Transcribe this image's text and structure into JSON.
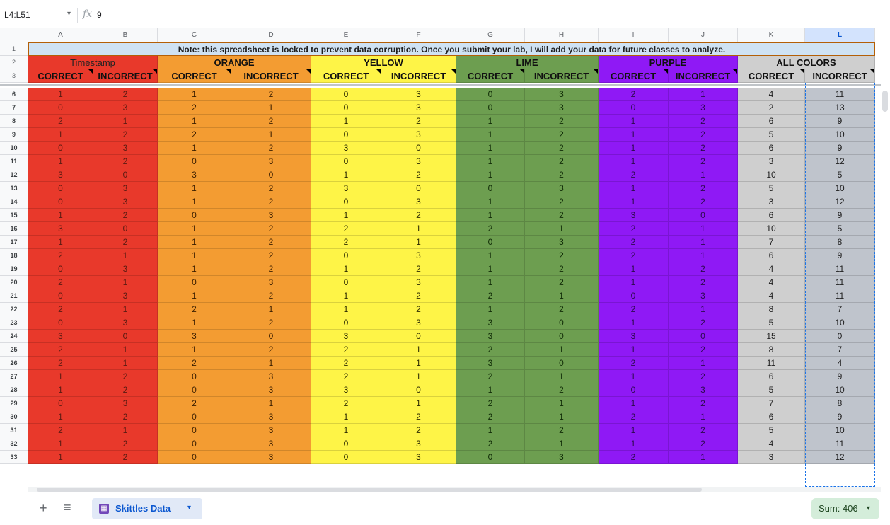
{
  "formula_bar": {
    "name_box": "L4:L51",
    "fx": "fx",
    "value": "9"
  },
  "columns": [
    "A",
    "B",
    "C",
    "D",
    "E",
    "F",
    "G",
    "H",
    "I",
    "J",
    "K",
    "L"
  ],
  "selected_column": "L",
  "top_rows": [
    "1",
    "2",
    "3"
  ],
  "note": "Note: this spreadsheet is locked to prevent data corruption. Once you submit your lab, I will add your data for future classes to analyze.",
  "headers": {
    "timestamp": "Timestamp",
    "orange": "ORANGE",
    "yellow": "YELLOW",
    "lime": "LIME",
    "purple": "PURPLE",
    "all_colors": "ALL COLORS",
    "correct": "CORRECT",
    "incorrect": "INCORRECT"
  },
  "colors": {
    "red": "#e8392b",
    "orange": "#f39c32",
    "yellow": "#fef447",
    "lime": "#6d9e50",
    "purple": "#8f19f5",
    "gray": "#cfcfcf",
    "gray_sel": "#bfc4cc",
    "note_bg": "#cfe2f3"
  },
  "rows": [
    {
      "n": "6",
      "v": [
        "1",
        "2",
        "1",
        "2",
        "0",
        "3",
        "0",
        "3",
        "2",
        "1",
        "4",
        "11"
      ]
    },
    {
      "n": "7",
      "v": [
        "0",
        "3",
        "2",
        "1",
        "0",
        "3",
        "0",
        "3",
        "0",
        "3",
        "2",
        "13"
      ]
    },
    {
      "n": "8",
      "v": [
        "2",
        "1",
        "1",
        "2",
        "1",
        "2",
        "1",
        "2",
        "1",
        "2",
        "6",
        "9"
      ]
    },
    {
      "n": "9",
      "v": [
        "1",
        "2",
        "2",
        "1",
        "0",
        "3",
        "1",
        "2",
        "1",
        "2",
        "5",
        "10"
      ]
    },
    {
      "n": "10",
      "v": [
        "0",
        "3",
        "1",
        "2",
        "3",
        "0",
        "1",
        "2",
        "1",
        "2",
        "6",
        "9"
      ]
    },
    {
      "n": "11",
      "v": [
        "1",
        "2",
        "0",
        "3",
        "0",
        "3",
        "1",
        "2",
        "1",
        "2",
        "3",
        "12"
      ]
    },
    {
      "n": "12",
      "v": [
        "3",
        "0",
        "3",
        "0",
        "1",
        "2",
        "1",
        "2",
        "2",
        "1",
        "10",
        "5"
      ]
    },
    {
      "n": "13",
      "v": [
        "0",
        "3",
        "1",
        "2",
        "3",
        "0",
        "0",
        "3",
        "1",
        "2",
        "5",
        "10"
      ]
    },
    {
      "n": "14",
      "v": [
        "0",
        "3",
        "1",
        "2",
        "0",
        "3",
        "1",
        "2",
        "1",
        "2",
        "3",
        "12"
      ]
    },
    {
      "n": "15",
      "v": [
        "1",
        "2",
        "0",
        "3",
        "1",
        "2",
        "1",
        "2",
        "3",
        "0",
        "6",
        "9"
      ]
    },
    {
      "n": "16",
      "v": [
        "3",
        "0",
        "1",
        "2",
        "2",
        "1",
        "2",
        "1",
        "2",
        "1",
        "10",
        "5"
      ]
    },
    {
      "n": "17",
      "v": [
        "1",
        "2",
        "1",
        "2",
        "2",
        "1",
        "0",
        "3",
        "2",
        "1",
        "7",
        "8"
      ]
    },
    {
      "n": "18",
      "v": [
        "2",
        "1",
        "1",
        "2",
        "0",
        "3",
        "1",
        "2",
        "2",
        "1",
        "6",
        "9"
      ]
    },
    {
      "n": "19",
      "v": [
        "0",
        "3",
        "1",
        "2",
        "1",
        "2",
        "1",
        "2",
        "1",
        "2",
        "4",
        "11"
      ]
    },
    {
      "n": "20",
      "v": [
        "2",
        "1",
        "0",
        "3",
        "0",
        "3",
        "1",
        "2",
        "1",
        "2",
        "4",
        "11"
      ]
    },
    {
      "n": "21",
      "v": [
        "0",
        "3",
        "1",
        "2",
        "1",
        "2",
        "2",
        "1",
        "0",
        "3",
        "4",
        "11"
      ]
    },
    {
      "n": "22",
      "v": [
        "2",
        "1",
        "2",
        "1",
        "1",
        "2",
        "1",
        "2",
        "2",
        "1",
        "8",
        "7"
      ]
    },
    {
      "n": "23",
      "v": [
        "0",
        "3",
        "1",
        "2",
        "0",
        "3",
        "3",
        "0",
        "1",
        "2",
        "5",
        "10"
      ]
    },
    {
      "n": "24",
      "v": [
        "3",
        "0",
        "3",
        "0",
        "3",
        "0",
        "3",
        "0",
        "3",
        "0",
        "15",
        "0"
      ]
    },
    {
      "n": "25",
      "v": [
        "2",
        "1",
        "1",
        "2",
        "2",
        "1",
        "2",
        "1",
        "1",
        "2",
        "8",
        "7"
      ]
    },
    {
      "n": "26",
      "v": [
        "2",
        "1",
        "2",
        "1",
        "2",
        "1",
        "3",
        "0",
        "2",
        "1",
        "11",
        "4"
      ]
    },
    {
      "n": "27",
      "v": [
        "1",
        "2",
        "0",
        "3",
        "2",
        "1",
        "2",
        "1",
        "1",
        "2",
        "6",
        "9"
      ]
    },
    {
      "n": "28",
      "v": [
        "1",
        "2",
        "0",
        "3",
        "3",
        "0",
        "1",
        "2",
        "0",
        "3",
        "5",
        "10"
      ]
    },
    {
      "n": "29",
      "v": [
        "0",
        "3",
        "2",
        "1",
        "2",
        "1",
        "2",
        "1",
        "1",
        "2",
        "7",
        "8"
      ]
    },
    {
      "n": "30",
      "v": [
        "1",
        "2",
        "0",
        "3",
        "1",
        "2",
        "2",
        "1",
        "2",
        "1",
        "6",
        "9"
      ]
    },
    {
      "n": "31",
      "v": [
        "2",
        "1",
        "0",
        "3",
        "1",
        "2",
        "1",
        "2",
        "1",
        "2",
        "5",
        "10"
      ]
    },
    {
      "n": "32",
      "v": [
        "1",
        "2",
        "0",
        "3",
        "0",
        "3",
        "2",
        "1",
        "1",
        "2",
        "4",
        "11"
      ]
    },
    {
      "n": "33",
      "v": [
        "1",
        "2",
        "0",
        "3",
        "0",
        "3",
        "0",
        "3",
        "2",
        "1",
        "3",
        "12"
      ]
    }
  ],
  "bottom": {
    "add": "+",
    "menu": "≡",
    "sheet_tab": "Skittles Data",
    "sum": "Sum: 406"
  },
  "icons": {
    "add": "plus-icon",
    "menu": "hamburger-icon",
    "sheet": "sheet-grid-icon",
    "caret": "chevron-down-icon"
  }
}
